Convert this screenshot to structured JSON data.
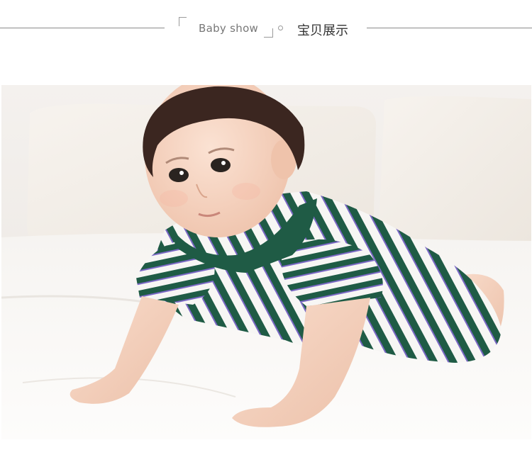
{
  "section_header": {
    "english_title": "Baby show",
    "chinese_title": "宝贝展示"
  },
  "photo": {
    "icon": "baby-photo",
    "colors": {
      "background": "#f2efec",
      "bedsheet": "#fbfaf8",
      "romper_green": "#1f5b45",
      "romper_purple": "#7a68c4"
    }
  }
}
